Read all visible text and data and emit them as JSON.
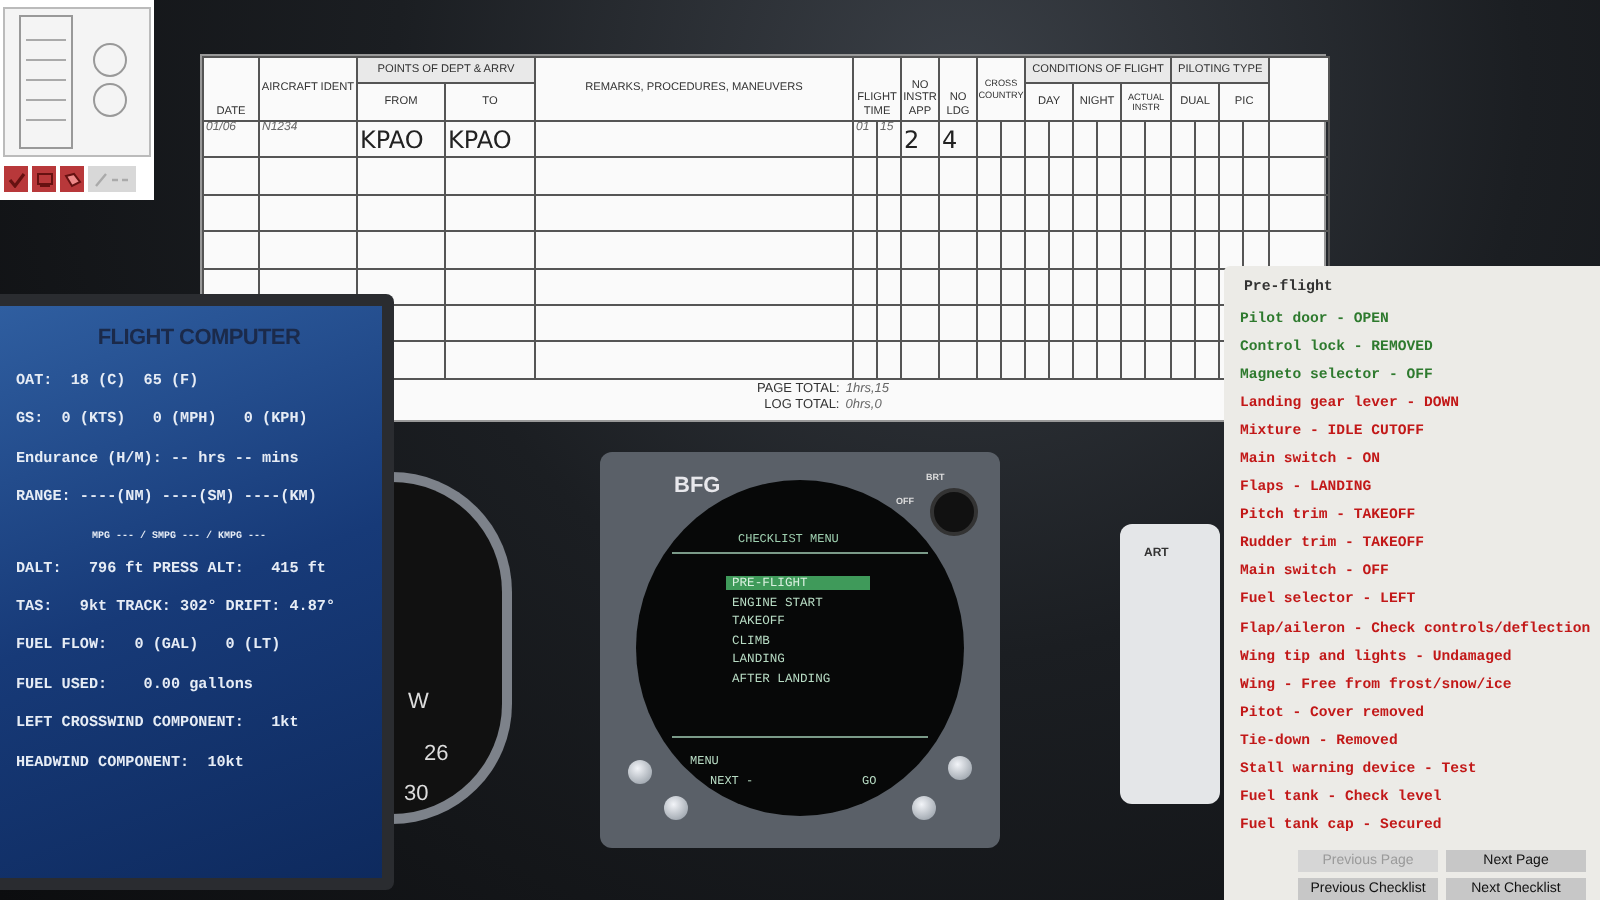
{
  "thumbnail": {
    "buttons": [
      {
        "kind": "check",
        "disabled": false
      },
      {
        "kind": "screen",
        "disabled": false
      },
      {
        "kind": "book",
        "disabled": false
      },
      {
        "kind": "arrows",
        "disabled": true
      }
    ]
  },
  "logbook": {
    "headers": {
      "date": "DATE",
      "aircraft_ident": "AIRCRAFT IDENT",
      "points": "POINTS OF DEPT & ARRV",
      "from": "FROM",
      "to": "TO",
      "remarks": "REMARKS, PROCEDURES, MANEUVERS",
      "flight_time": "FLIGHT TIME",
      "instr_app": "NO INSTR APP",
      "landings": "NO LDG",
      "cross_country": "CROSS COUNTRY",
      "conditions": "CONDITIONS OF FLIGHT",
      "day": "DAY",
      "night": "NIGHT",
      "actual_instr": "ACTUAL INSTR",
      "piloting": "PILOTING TYPE",
      "dual": "DUAL",
      "pic": "PIC"
    },
    "entry": {
      "date": "01/06",
      "aircraft_ident": "N1234",
      "from": "KPAO",
      "to": "KPAO",
      "flight_time_hours": "01",
      "flight_time_minutes": "15",
      "instr_app": "2",
      "landings": "4"
    },
    "page_total_label": "PAGE TOTAL:",
    "page_total": "1hrs,15",
    "log_total_label": "LOG TOTAL:",
    "log_total": "0hrs,0"
  },
  "flight_computer": {
    "title": "FLIGHT COMPUTER",
    "lines": [
      {
        "kind": "line",
        "text": "OAT:  18 (C)  65 (F)"
      },
      {
        "kind": "line",
        "text": "GS:  0 (KTS)   0 (MPH)   0 (KPH)"
      },
      {
        "kind": "line",
        "text": "Endurance (H/M): -- hrs -- mins"
      },
      {
        "kind": "line",
        "text": "RANGE: ----(NM) ----(SM) ----(KM)"
      },
      {
        "kind": "small",
        "text": "MPG --- / SMPG --- / KMPG ---"
      },
      {
        "kind": "line",
        "text": "DALT:   796 ft PRESS ALT:   415 ft"
      },
      {
        "kind": "line",
        "text": "TAS:   9kt TRACK: 302° DRIFT: 4.87°"
      },
      {
        "kind": "line",
        "text": "FUEL FLOW:   0 (GAL)   0 (LT)"
      },
      {
        "kind": "line",
        "text": "FUEL USED:    0.00 gallons"
      },
      {
        "kind": "line",
        "text": "LEFT CROSSWIND COMPONENT:   1kt"
      },
      {
        "kind": "line",
        "text": "HEADWIND COMPONENT:  10kt"
      }
    ]
  },
  "gauge": {
    "labels": [
      "W",
      "26",
      "30"
    ]
  },
  "checklist_device": {
    "logo": "BFG",
    "brightness_label": "BRT",
    "off_label": "OFF",
    "title": "CHECKLIST MENU",
    "items": [
      {
        "label": "PRE-FLIGHT",
        "selected": true
      },
      {
        "label": "ENGINE START",
        "selected": false
      },
      {
        "label": "TAKEOFF",
        "selected": false
      },
      {
        "label": "CLIMB",
        "selected": false
      },
      {
        "label": "LANDING",
        "selected": false
      },
      {
        "label": "AFTER LANDING",
        "selected": false
      }
    ],
    "menu_label": "MENU",
    "next_label": "NEXT -",
    "go_label": "GO"
  },
  "right_gauge": {
    "label": "ART"
  },
  "checklist": {
    "title": "Pre-flight",
    "items": [
      {
        "text": "Pilot door - OPEN",
        "done": true
      },
      {
        "text": "Control lock - REMOVED",
        "done": true
      },
      {
        "text": "Magneto selector - OFF",
        "done": true
      },
      {
        "text": "Landing gear lever - DOWN",
        "done": false
      },
      {
        "text": "Mixture - IDLE CUTOFF",
        "done": false
      },
      {
        "text": "Main switch - ON",
        "done": false
      },
      {
        "text": "Flaps - LANDING",
        "done": false
      },
      {
        "text": "Pitch trim - TAKEOFF",
        "done": false
      },
      {
        "text": "Rudder trim - TAKEOFF",
        "done": false
      },
      {
        "text": "Main switch - OFF",
        "done": false
      },
      {
        "text": "Fuel selector - LEFT",
        "done": false
      },
      {
        "text": "Flap/aileron - Check controls/deflection",
        "done": false
      },
      {
        "text": "Wing tip and lights - Undamaged",
        "done": false
      },
      {
        "text": "Wing - Free from frost/snow/ice",
        "done": false
      },
      {
        "text": "Pitot - Cover removed",
        "done": false
      },
      {
        "text": "Tie-down - Removed",
        "done": false
      },
      {
        "text": "Stall warning device - Test",
        "done": false
      },
      {
        "text": "Fuel tank - Check level",
        "done": false
      },
      {
        "text": "Fuel tank cap - Secured",
        "done": false
      }
    ],
    "buttons": [
      {
        "label": "Previous Page",
        "disabled": true
      },
      {
        "label": "Next Page",
        "disabled": false
      },
      {
        "label": "Previous Checklist",
        "disabled": false
      },
      {
        "label": "Next Checklist",
        "disabled": false
      }
    ]
  }
}
